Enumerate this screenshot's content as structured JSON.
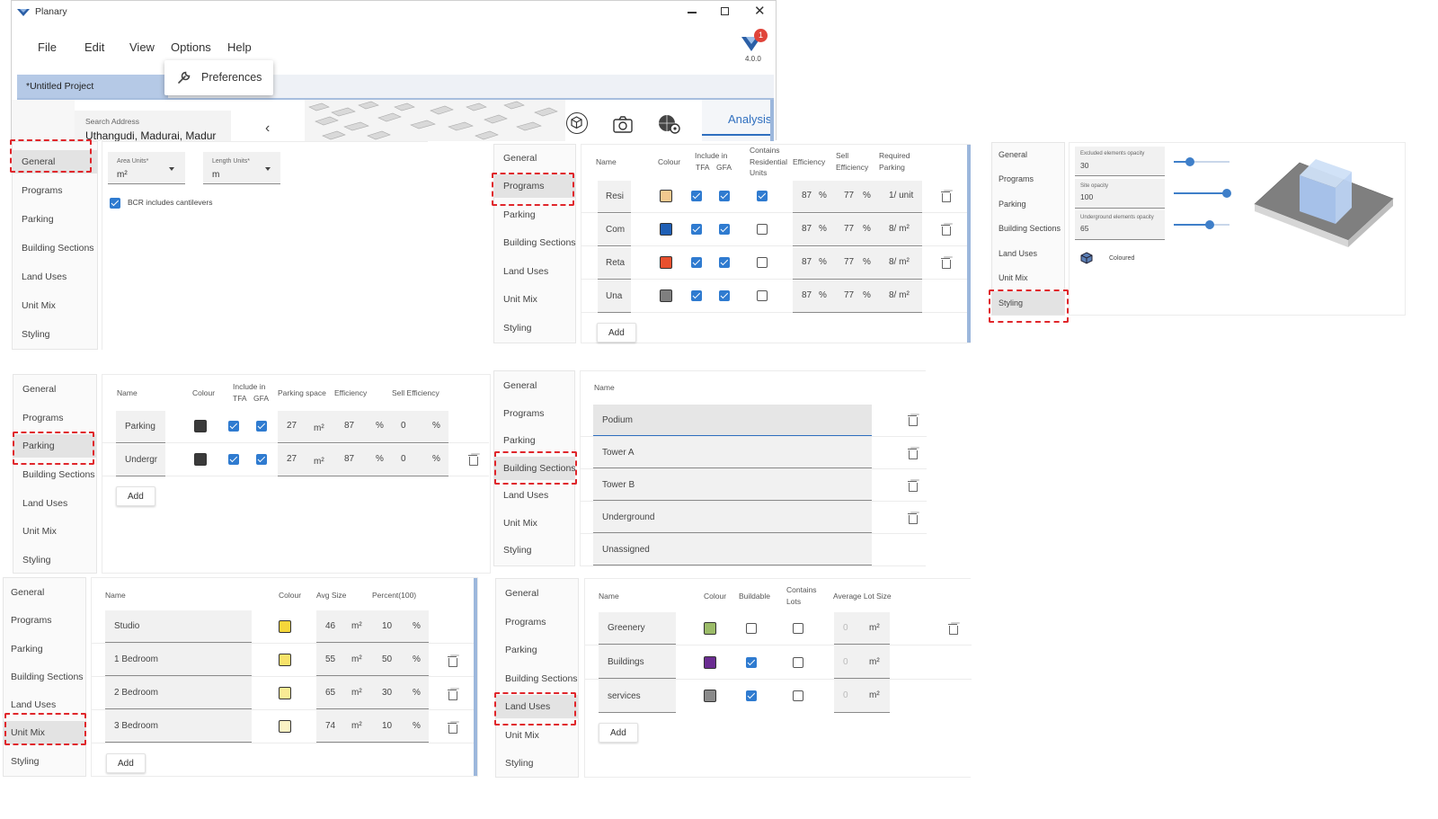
{
  "app": {
    "title": "Planary",
    "menu": [
      "File",
      "Edit",
      "View",
      "Options",
      "Help"
    ],
    "preferences": "Preferences",
    "project_tab": "*Untitled Project",
    "version": "4.0.0",
    "notification_count": "1",
    "search_label": "Search Address",
    "search_value": "Uthangudi, Madurai, Madur",
    "analysis_tab": "Analysis"
  },
  "nav_labels": [
    "General",
    "Programs",
    "Parking",
    "Building Sections",
    "Land Uses",
    "Unit Mix",
    "Styling"
  ],
  "general": {
    "area_units_label": "Area Units*",
    "area_units_value": "m²",
    "length_units_label": "Length Units*",
    "length_units_value": "m",
    "bcr_label": "BCR includes cantilevers"
  },
  "programs": {
    "headers": [
      "Name",
      "Colour",
      "Include in",
      "TFA",
      "GFA",
      "Contains",
      "Residential",
      "Units",
      "Efficiency",
      "Sell",
      "Efficiency",
      "Required",
      "Parking"
    ],
    "rows": [
      {
        "name": "Resi",
        "color": "#f3c98f",
        "tfa": true,
        "gfa": true,
        "res": true,
        "eff": "87",
        "sell": "77",
        "park": "1/ unit"
      },
      {
        "name": "Com",
        "color": "#1f5fb5",
        "tfa": true,
        "gfa": true,
        "res": false,
        "eff": "87",
        "sell": "77",
        "park": "8/ m²"
      },
      {
        "name": "Reta",
        "color": "#e8502e",
        "tfa": true,
        "gfa": true,
        "res": false,
        "eff": "87",
        "sell": "77",
        "park": "8/ m²"
      },
      {
        "name": "Una",
        "color": "#7f7f7f",
        "tfa": true,
        "gfa": true,
        "res": false,
        "eff": "87",
        "sell": "77",
        "park": "8/ m²"
      }
    ],
    "pct": "%",
    "add": "Add"
  },
  "styling": {
    "excluded_label": "Excluded elements opacity",
    "excluded_value": "30",
    "excluded_fraction": 0.3,
    "site_label": "Site opacity",
    "site_value": "100",
    "site_fraction": 1.0,
    "underground_label": "Underground elements opacity",
    "underground_value": "65",
    "underground_fraction": 0.65,
    "coloured_label": "Coloured"
  },
  "parking": {
    "headers": [
      "Name",
      "Colour",
      "Include in",
      "TFA",
      "GFA",
      "Parking space",
      "Efficiency",
      "Sell Efficiency"
    ],
    "rows": [
      {
        "name": "Parking",
        "space": "27",
        "eff": "87",
        "sell": "0"
      },
      {
        "name": "Undergr",
        "space": "27",
        "eff": "87",
        "sell": "0"
      }
    ],
    "unit": "m²",
    "pct": "%",
    "add": "Add"
  },
  "sections": {
    "header": "Name",
    "rows": [
      "Podium",
      "Tower A",
      "Tower B",
      "Underground",
      "Unassigned"
    ]
  },
  "unitmix": {
    "headers": [
      "Name",
      "Colour",
      "Avg Size",
      "Percent(100)"
    ],
    "rows": [
      {
        "name": "Studio",
        "color": "#f5d63a",
        "size": "46",
        "pct": "10"
      },
      {
        "name": "1 Bedroom",
        "color": "#f7e26a",
        "size": "55",
        "pct": "50"
      },
      {
        "name": "2 Bedroom",
        "color": "#f9eb94",
        "size": "65",
        "pct": "30"
      },
      {
        "name": "3 Bedroom",
        "color": "#fbf2c4",
        "size": "74",
        "pct": "10"
      }
    ],
    "unit": "m²",
    "pctsign": "%",
    "add": "Add"
  },
  "landuses": {
    "headers": [
      "Name",
      "Colour",
      "Buildable",
      "Contains",
      "Lots",
      "Average Lot Size"
    ],
    "rows": [
      {
        "name": "Greenery",
        "color": "#9bbb68",
        "buildable": false,
        "value": "0"
      },
      {
        "name": "Buildings",
        "color": "#6a2c91",
        "buildable": true,
        "value": "0"
      },
      {
        "name": "services",
        "color": "#8a8a8a",
        "buildable": true,
        "value": "0"
      }
    ],
    "unit": "m²",
    "add": "Add"
  },
  "colors": {
    "accent": "#2f7bd0",
    "highlight": "#e0262b",
    "parking_swatch": "#3a3a3a"
  }
}
